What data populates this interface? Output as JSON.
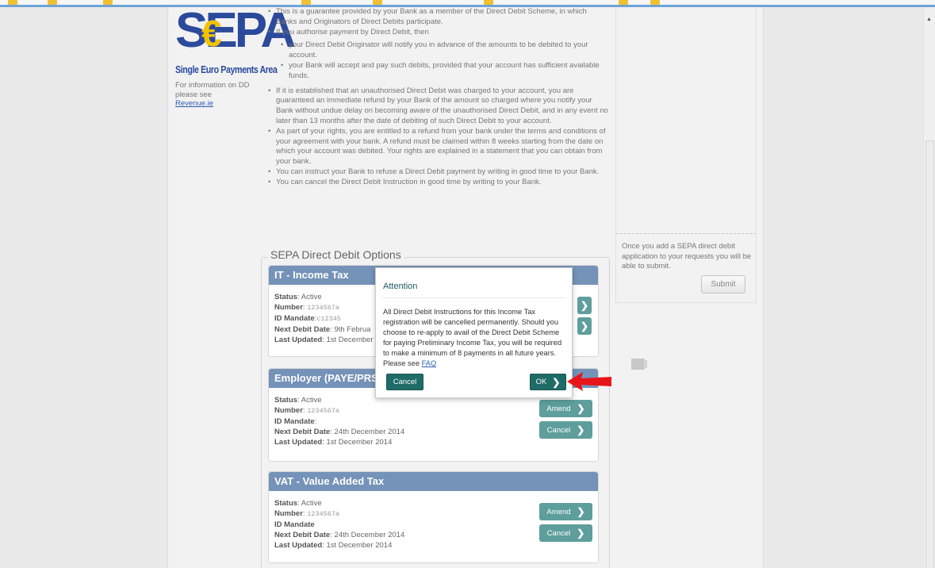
{
  "logo": {
    "big": "SEPA",
    "euro": "€",
    "subtitle": "Single Euro Payments Area",
    "icon": "sepa-logo"
  },
  "sidebar_info": {
    "text": "For information on DD please see",
    "link": "Revenue.ie"
  },
  "body": {
    "p1": "This is a guarantee provided by your Bank as a member of the Direct Debit Scheme, in which Banks and Originators of Direct Debits participate.",
    "p2": "If you authorise payment by Direct Debit, then",
    "sub1": "your Direct Debit Originator will notify you in advance of the amounts to be debited to your account.",
    "sub2": "your Bank will accept and pay such debits, provided that your account has sufficient available funds.",
    "p3": "If it is established that an unauthorised Direct Debit was charged to your account, you are guaranteed an immediate refund by your Bank of the amount so charged where you notify your Bank without undue delay on becoming aware of the unauthorised Direct Debit, and in any event no later than 13 months after the date of debiting of such Direct Debit to your account.",
    "p4": "As part of your rights, you are entitled to a refund from your bank under the terms and conditions of your agreement with your bank. A refund must be claimed within 8 weeks starting from the date on which your account was debited. Your rights are explained in a statement that you can obtain from your bank.",
    "p5": "You can instruct your Bank to refuse a Direct Debit payment by writing in good time to your Bank.",
    "p6": "You can cancel the Direct Debit Instruction in good time by writing to your Bank."
  },
  "right_panel": {
    "text": "Once you add a SEPA direct debit application to your requests you will be able to submit.",
    "submit": "Submit"
  },
  "section_title": "SEPA Direct Debit Options",
  "labels": {
    "status": "Status",
    "number": "Number",
    "id_mandate": "ID Mandate",
    "next_debit": "Next Debit Date",
    "last_updated": "Last Updated",
    "amend": "Amend",
    "cancel": "Cancel"
  },
  "cards": [
    {
      "title": "IT - Income Tax",
      "status": ": Active",
      "number": "1234567a",
      "mandate": "c12345",
      "next_debit": ": 9th Februa",
      "last_updated": ": 1st December"
    },
    {
      "title": "Employer (PAYE/PRSI)",
      "status": ": Active",
      "number": "1234567a",
      "mandate": "",
      "next_debit": ": 24th December 2014",
      "last_updated": ": 1st December 2014"
    },
    {
      "title": "VAT - Value Added Tax",
      "status": ": Active",
      "number": "1234567a",
      "mandate": "",
      "next_debit": ": 24th December 2014",
      "last_updated": ": 1st December 2014"
    }
  ],
  "modal": {
    "title": "Attention",
    "message": "All Direct Debit Instructions for this Income Tax registration will be cancelled permanently. Should you choose to re-apply to avail of the Direct Debit Scheme for paying Preliminary Income Tax, you will be required to make a minimum of 8 payments in all future years. Please see ",
    "link": "FAQ",
    "cancel": "Cancel",
    "ok": "OK"
  },
  "colors": {
    "card_header": "#7592b8",
    "button_teal": "#5e9e9c",
    "modal_button": "#1f6b67",
    "arrow": "#e8151b"
  },
  "icons": {
    "chevron": "chevron-right-icon",
    "arrow": "red-arrow-icon",
    "scroll_up": "scroll-up-arrow-icon"
  }
}
